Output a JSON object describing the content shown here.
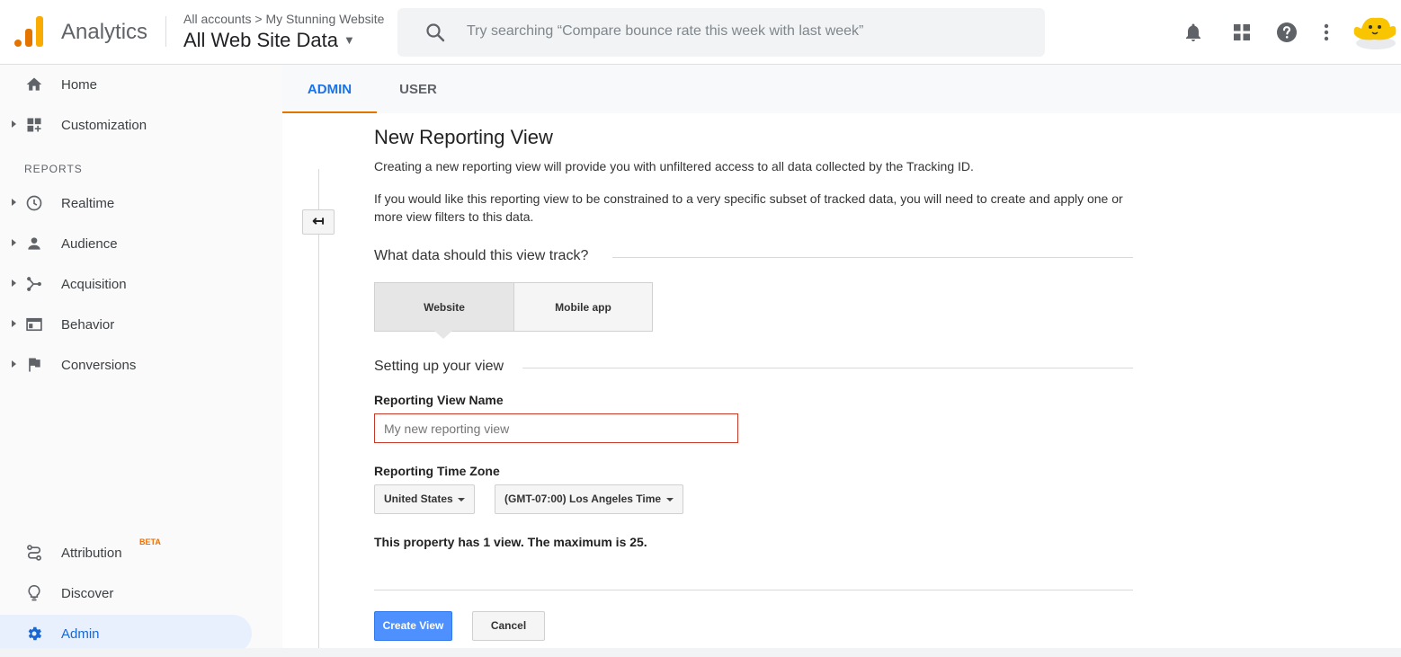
{
  "header": {
    "brand": "Analytics",
    "breadcrumb": "All accounts > My Stunning Website",
    "view_name": "All Web Site Data",
    "search_placeholder": "Try searching “Compare bounce rate this week with last week”",
    "icons": [
      "notifications-icon",
      "apps-grid-icon",
      "help-icon",
      "more-vert-icon"
    ]
  },
  "sidebar": {
    "top_items": [
      {
        "label": "Home",
        "icon": "home-icon"
      },
      {
        "label": "Customization",
        "icon": "dashboard-icon"
      }
    ],
    "reports_label": "REPORTS",
    "report_items": [
      {
        "label": "Realtime",
        "icon": "clock-icon"
      },
      {
        "label": "Audience",
        "icon": "person-icon"
      },
      {
        "label": "Acquisition",
        "icon": "acquisition-icon"
      },
      {
        "label": "Behavior",
        "icon": "behavior-icon"
      },
      {
        "label": "Conversions",
        "icon": "flag-icon"
      }
    ],
    "bottom_items": [
      {
        "label": "Attribution",
        "badge": "BETA",
        "icon": "attribution-icon"
      },
      {
        "label": "Discover",
        "icon": "lightbulb-icon"
      },
      {
        "label": "Admin",
        "icon": "gear-icon",
        "active": true
      }
    ]
  },
  "tabs": [
    {
      "label": "ADMIN",
      "active": true
    },
    {
      "label": "USER",
      "active": false
    }
  ],
  "form": {
    "title": "New Reporting View",
    "intro": "Creating a new reporting view will provide you with unfiltered access to all data collected by the Tracking ID.",
    "filters_note": "If you would like this reporting view to be constrained to a very specific subset of tracked data, you will need to create and apply one or more view filters to this data.",
    "track_heading": "What data should this view track?",
    "track_options": [
      {
        "label": "Website",
        "selected": true
      },
      {
        "label": "Mobile app",
        "selected": false
      }
    ],
    "setup_heading": "Setting up your view",
    "name_label": "Reporting View Name",
    "name_placeholder": "My new reporting view",
    "name_value": "",
    "timezone_label": "Reporting Time Zone",
    "country_value": "United States",
    "timezone_value": "(GMT-07:00) Los Angeles Time",
    "limit_note": "This property has 1 view. The maximum is 25.",
    "create_label": "Create View",
    "cancel_label": "Cancel"
  },
  "colors": {
    "accent_blue": "#1a73e8",
    "tab_underline": "#e37400",
    "primary_button": "#4d90fe",
    "error_border": "#c53929",
    "active_nav_bg": "#e8f0fe"
  }
}
